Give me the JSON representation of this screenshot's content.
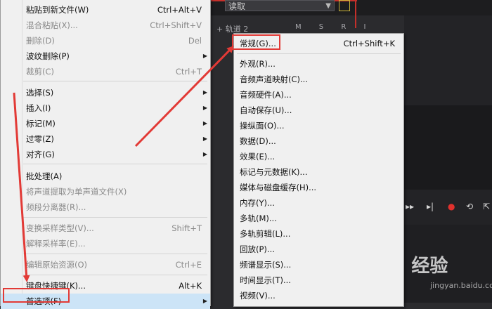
{
  "app": {
    "dropdown_value": "读取",
    "track_label": "+ 轨道 2",
    "track_buttons": "M S R I"
  },
  "left_menu": [
    {
      "label": "粘贴到新文件(W)",
      "shortcut": "Ctrl+Alt+V",
      "disabled": false
    },
    {
      "label": "混合粘贴(X)...",
      "shortcut": "Ctrl+Shift+V",
      "disabled": true
    },
    {
      "label": "删除(D)",
      "shortcut": "Del",
      "disabled": true
    },
    {
      "label": "波纹删除(P)",
      "shortcut": "",
      "disabled": false,
      "submenu": true
    },
    {
      "label": "裁剪(C)",
      "shortcut": "Ctrl+T",
      "disabled": true
    },
    {
      "label": "选择(S)",
      "shortcut": "",
      "disabled": false,
      "submenu": true
    },
    {
      "label": "插入(I)",
      "shortcut": "",
      "disabled": false,
      "submenu": true
    },
    {
      "label": "标记(M)",
      "shortcut": "",
      "disabled": false,
      "submenu": true
    },
    {
      "label": "过零(Z)",
      "shortcut": "",
      "disabled": false,
      "submenu": true
    },
    {
      "label": "对齐(G)",
      "shortcut": "",
      "disabled": false,
      "submenu": true
    },
    {
      "label": "批处理(A)",
      "shortcut": "",
      "disabled": false
    },
    {
      "label": "将声道提取为单声道文件(X)",
      "shortcut": "",
      "disabled": true
    },
    {
      "label": "频段分离器(R)...",
      "shortcut": "",
      "disabled": true
    },
    {
      "label": "变换采样类型(V)...",
      "shortcut": "Shift+T",
      "disabled": true
    },
    {
      "label": "解释采样率(E)...",
      "shortcut": "",
      "disabled": true
    },
    {
      "label": "编辑原始资源(O)",
      "shortcut": "Ctrl+E",
      "disabled": true
    },
    {
      "label": "键盘快捷键(K)...",
      "shortcut": "Alt+K",
      "disabled": false
    },
    {
      "label": "首选项(F)",
      "shortcut": "",
      "disabled": false,
      "submenu": true,
      "highlighted": true
    }
  ],
  "right_menu": [
    {
      "label": "常规(G)...",
      "shortcut": "Ctrl+Shift+K"
    },
    {
      "label": "外观(R)...",
      "shortcut": ""
    },
    {
      "label": "音频声道映射(C)...",
      "shortcut": ""
    },
    {
      "label": "音频硬件(A)...",
      "shortcut": ""
    },
    {
      "label": "自动保存(U)...",
      "shortcut": ""
    },
    {
      "label": "操纵面(O)...",
      "shortcut": ""
    },
    {
      "label": "数据(D)...",
      "shortcut": ""
    },
    {
      "label": "效果(E)...",
      "shortcut": ""
    },
    {
      "label": "标记与元数据(K)...",
      "shortcut": ""
    },
    {
      "label": "媒体与磁盘缓存(H)...",
      "shortcut": ""
    },
    {
      "label": "内存(Y)...",
      "shortcut": ""
    },
    {
      "label": "多轨(M)...",
      "shortcut": ""
    },
    {
      "label": "多轨剪辑(L)...",
      "shortcut": ""
    },
    {
      "label": "回放(P)...",
      "shortcut": ""
    },
    {
      "label": "频谱显示(S)...",
      "shortcut": ""
    },
    {
      "label": "时间显示(T)...",
      "shortcut": ""
    },
    {
      "label": "视频(V)...",
      "shortcut": ""
    }
  ],
  "watermark": {
    "text": "Bai 经验",
    "sub": "jingyan.baidu.com"
  },
  "colors": {
    "annotation_red": "#e23a36",
    "menu_bg": "#f0f0f0",
    "highlight": "#cce4f7"
  }
}
